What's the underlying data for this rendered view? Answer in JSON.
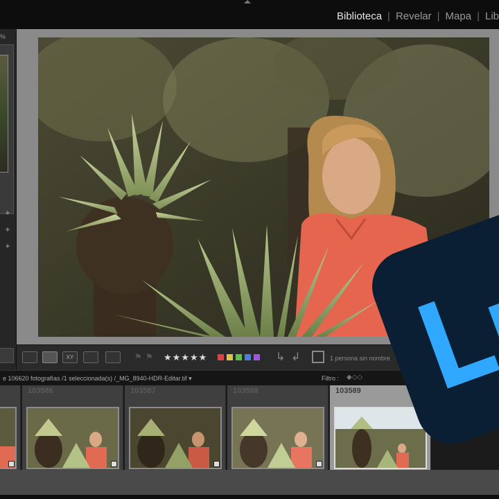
{
  "modules": [
    {
      "label": "Biblioteca",
      "active": true
    },
    {
      "label": "Revelar",
      "active": false
    },
    {
      "label": "Mapa",
      "active": false
    },
    {
      "label": "Libr",
      "active": false
    }
  ],
  "left_panel": {
    "zoom_fragment": "%"
  },
  "toolbar": {
    "stars": "★★★★★",
    "swatches": [
      "#d64545",
      "#d8c54a",
      "#5fbf4e",
      "#4a7ee0",
      "#9a5ad6"
    ],
    "face_text": "1 persona sin nombre"
  },
  "filmstrip": {
    "path_text": "e 106620 fotografías /1 seleccionada(s) /_MG_8940-HDR-Editar.tif",
    "filter_label": "Filtro :",
    "cells": [
      {
        "num": ""
      },
      {
        "num": "103586"
      },
      {
        "num": "103587"
      },
      {
        "num": "103588"
      },
      {
        "num": "103589",
        "selected": true
      }
    ]
  },
  "logo": {
    "letters": "Lr",
    "bg": "#0a1f33",
    "fg": "#31a8ff"
  },
  "colors": {
    "topbar": "#0d0d0d",
    "viewer": "#8a8a8a",
    "toolbar": "#2a2a2a"
  }
}
